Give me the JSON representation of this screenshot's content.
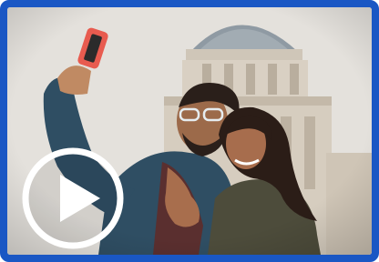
{
  "video": {
    "state": "paused",
    "accent_color": "#1a57c4",
    "thumbnail": "couple-taking-selfie-in-front-of-domed-building",
    "play_icon": "play-icon"
  }
}
